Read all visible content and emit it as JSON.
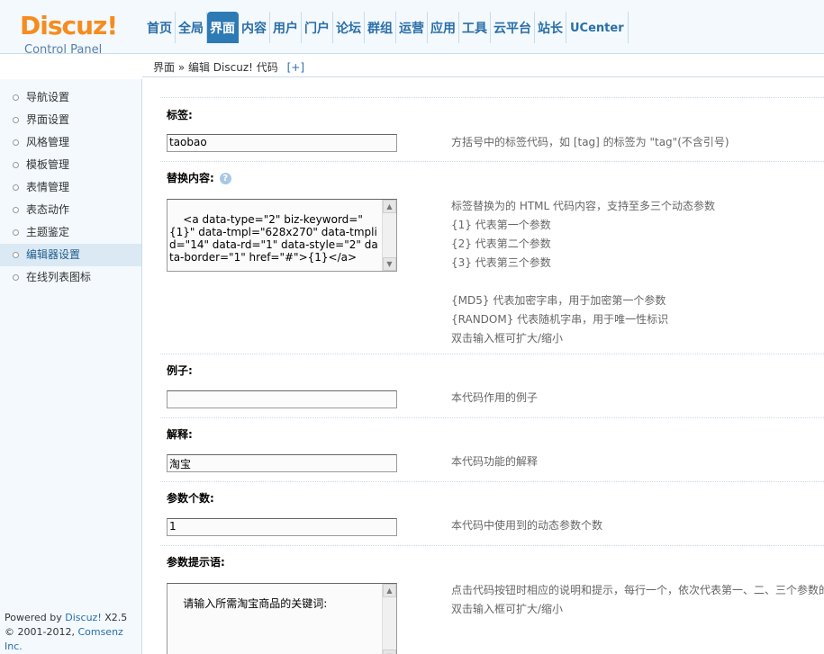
{
  "logo": {
    "main": "Discuz!",
    "sub": "Control Panel"
  },
  "nav": [
    {
      "label": "首页",
      "active": false
    },
    {
      "label": "全局",
      "active": false
    },
    {
      "label": "界面",
      "active": true
    },
    {
      "label": "内容",
      "active": false
    },
    {
      "label": "用户",
      "active": false
    },
    {
      "label": "门户",
      "active": false
    },
    {
      "label": "论坛",
      "active": false
    },
    {
      "label": "群组",
      "active": false
    },
    {
      "label": "运营",
      "active": false
    },
    {
      "label": "应用",
      "active": false
    },
    {
      "label": "工具",
      "active": false
    },
    {
      "label": "云平台",
      "active": false
    },
    {
      "label": "站长",
      "active": false
    },
    {
      "label": "UCenter",
      "active": false
    }
  ],
  "breadcrumb": {
    "text": "界面 » 编辑 Discuz! 代码",
    "add": "[+]"
  },
  "sidebar": {
    "items": [
      {
        "label": "导航设置",
        "active": false
      },
      {
        "label": "界面设置",
        "active": false
      },
      {
        "label": "风格管理",
        "active": false
      },
      {
        "label": "模板管理",
        "active": false
      },
      {
        "label": "表情管理",
        "active": false
      },
      {
        "label": "表态动作",
        "active": false
      },
      {
        "label": "主题鉴定",
        "active": false
      },
      {
        "label": "编辑器设置",
        "active": true
      },
      {
        "label": "在线列表图标",
        "active": false
      }
    ],
    "footer": {
      "powered_prefix": "Powered by ",
      "powered_brand": "Discuz!",
      "powered_version": " X2.5",
      "copyright_prefix": "© 2001-2012, ",
      "copyright_brand": "Comsenz Inc."
    }
  },
  "form": {
    "tag": {
      "label": "标签:",
      "value": "taobao",
      "tip": "方括号中的标签代码，如 [tag] 的标签为 \"tag\"(不含引号)"
    },
    "replace": {
      "label": "替换内容:",
      "help_icon": "?",
      "value": "<a data-type=\"2\" biz-keyword=\"{1}\" data-tmpl=\"628x270\" data-tmplid=\"14\" data-rd=\"1\" data-style=\"2\" data-border=\"1\" href=\"#\">{1}</a>",
      "tips": [
        "标签替换为的 HTML 代码内容，支持至多三个动态参数",
        "{1} 代表第一个参数",
        "{2} 代表第二个参数",
        "{3} 代表第三个参数",
        "",
        "{MD5} 代表加密字串，用于加密第一个参数",
        "{RANDOM} 代表随机字串，用于唯一性标识",
        "双击输入框可扩大/缩小"
      ]
    },
    "example": {
      "label": "例子:",
      "value": "",
      "tip": "本代码作用的例子"
    },
    "explain": {
      "label": "解释:",
      "value": "淘宝",
      "tip": "本代码功能的解释"
    },
    "params": {
      "label": "参数个数:",
      "value": "1",
      "tip": "本代码中使用到的动态参数个数"
    },
    "prompt": {
      "label": "参数提示语:",
      "value": "请输入所需淘宝商品的关键词:",
      "tips": [
        "点击代码按钮时相应的说明和提示，每行一个，依次代表第一、二、三个参数的",
        "双击输入框可扩大/缩小"
      ]
    }
  }
}
